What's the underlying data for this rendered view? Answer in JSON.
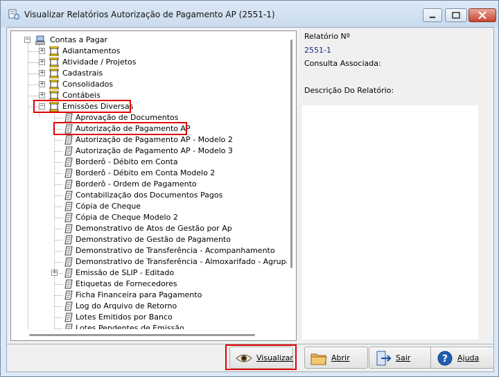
{
  "window": {
    "title": "Visualizar Relatórios Autorização de Pagamento AP (2551-1)"
  },
  "tree": {
    "root": "Contas a Pagar",
    "groups": [
      "Adiantamentos",
      "Atividade / Projetos",
      "Cadastrais",
      "Consolidados",
      "Contábeis",
      "Emissões Diversas"
    ],
    "reports": [
      "Aprovação de Documentos",
      "Autorização de Pagamento AP",
      "Autorização de Pagamento AP - Modelo 2",
      "Autorização de Pagamento AP - Modelo 3",
      "Borderô - Débito em Conta",
      "Borderô - Débito em Conta Modelo 2",
      "Borderô - Ordem de Pagamento",
      "Contabilização dos Documentos Pagos",
      "Cópia de Cheque",
      "Cópia de Cheque Modelo 2",
      "Demonstrativo de Atos de Gestão por Ap",
      "Demonstrativo de Gestão de Pagamento",
      "Demonstrativo de Transferência - Acompanhamento",
      "Demonstrativo de Transferência - Almoxarifado - Agrupa/Pa",
      "Emissão de SLIP - Editado",
      "Etiquetas de Fornecedores",
      "Ficha Financeira para Pagamento",
      "Log do Arquivo de Retorno",
      "Lotes Emitidos por Banco",
      "Lotes Pendentes de Emissão"
    ]
  },
  "info": {
    "relatorio_label": "Relatório Nº",
    "relatorio_value": "2551-1",
    "consulta_label": "Consulta Associada:",
    "descricao_label": "Descrição Do Relatório:"
  },
  "buttons": {
    "visualizar": "Visualizar",
    "abrir": "Abrir",
    "sair": "Sair",
    "ajuda": "Ajuda"
  },
  "colors": {
    "highlight": "#e00000",
    "value_text": "#1b2a7a"
  }
}
